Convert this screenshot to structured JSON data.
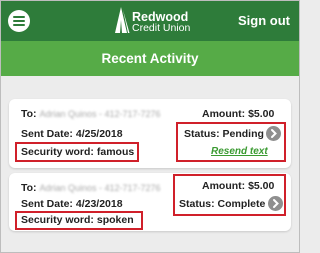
{
  "header": {
    "logo_line1": "Redwood",
    "logo_line2": "Credit Union",
    "signout_label": "Sign out"
  },
  "page": {
    "title": "Recent Activity"
  },
  "labels": {
    "to": "To:",
    "sent_date": "Sent Date:",
    "security_word": "Security word:",
    "amount": "Amount:",
    "status": "Status:"
  },
  "transactions": [
    {
      "recipient": "Adrian Quinos - 412-717-7276",
      "sent_date": "4/25/2018",
      "security_word": "famous",
      "amount": "$5.00",
      "status": "Pending",
      "resend_label": "Resend text"
    },
    {
      "recipient": "Adrian Quinos - 412-717-7276",
      "sent_date": "4/23/2018",
      "security_word": "spoken",
      "amount": "$5.00",
      "status": "Complete"
    }
  ],
  "colors": {
    "header": "#2e7c3a",
    "titlebar": "#56ab47",
    "highlight": "#d0202a",
    "link": "#3a9a31"
  }
}
